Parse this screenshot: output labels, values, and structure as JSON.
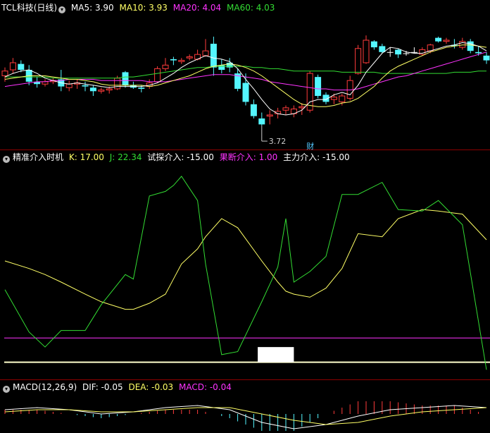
{
  "colors": {
    "up": "#ff3b3b",
    "down": "#54f6ff",
    "white": "#ffffff",
    "yellow": "#ffff66",
    "magenta": "#ff33ff",
    "green": "#33dd33"
  },
  "main_header": {
    "title": "TCL科技(日线)",
    "ma5": "MA5: 3.90",
    "ma10": "MA10: 3.93",
    "ma20": "MA20: 4.04",
    "ma60": "MA60: 4.03"
  },
  "ind_header": {
    "title": "精准介入时机",
    "k": "K: 17.00",
    "j": "J: 22.34",
    "test": "试探介入: -15.00",
    "decisive": "果断介入: 1.00",
    "main": "主力介入: -15.00"
  },
  "macd_header": {
    "title": "MACD(12,26,9)",
    "dif": "DIF: -0.05",
    "dea": "DEA: -0.03",
    "macd": "MACD: -0.04"
  },
  "annotations": {
    "low_label": "3.72",
    "marker": "财"
  },
  "chart_data": [
    {
      "type": "candlestick",
      "ylim": [
        3.55,
        4.65
      ],
      "candles": [
        [
          4.13,
          4.2,
          4.08,
          4.17
        ],
        [
          4.18,
          4.28,
          4.15,
          4.24
        ],
        [
          4.23,
          4.26,
          4.16,
          4.18
        ],
        [
          4.18,
          4.22,
          4.05,
          4.08
        ],
        [
          4.08,
          4.12,
          4.03,
          4.06
        ],
        [
          4.06,
          4.1,
          4.04,
          4.08
        ],
        [
          4.08,
          4.11,
          4.06,
          4.09
        ],
        [
          4.1,
          4.18,
          4.0,
          4.04
        ],
        [
          4.03,
          4.09,
          4.0,
          4.06
        ],
        [
          4.06,
          4.1,
          4.02,
          4.07
        ],
        [
          4.05,
          4.08,
          4.0,
          4.04
        ],
        [
          4.03,
          4.05,
          3.96,
          4.0
        ],
        [
          4.0,
          4.03,
          3.98,
          4.01
        ],
        [
          4.01,
          4.04,
          3.98,
          4.02
        ],
        [
          4.02,
          4.13,
          4.01,
          4.11
        ],
        [
          4.16,
          4.17,
          4.03,
          4.05
        ],
        [
          4.05,
          4.08,
          4.02,
          4.03
        ],
        [
          4.03,
          4.05,
          3.99,
          4.02
        ],
        [
          4.04,
          4.1,
          4.02,
          4.07
        ],
        [
          4.08,
          4.21,
          4.07,
          4.19
        ],
        [
          4.19,
          4.28,
          4.17,
          4.22
        ],
        [
          4.27,
          4.29,
          4.22,
          4.26
        ],
        [
          4.25,
          4.28,
          4.23,
          4.26
        ],
        [
          4.28,
          4.31,
          4.26,
          4.29
        ],
        [
          4.27,
          4.35,
          4.26,
          4.31
        ],
        [
          4.3,
          4.44,
          4.29,
          4.34
        ],
        [
          4.4,
          4.46,
          4.13,
          4.2
        ],
        [
          4.22,
          4.27,
          4.15,
          4.18
        ],
        [
          4.24,
          4.28,
          4.16,
          4.2
        ],
        [
          4.15,
          4.19,
          4.0,
          4.02
        ],
        [
          4.07,
          4.15,
          3.88,
          3.91
        ],
        [
          3.89,
          3.93,
          3.77,
          3.79
        ],
        [
          3.77,
          3.82,
          3.71,
          3.72
        ],
        [
          3.79,
          3.84,
          3.72,
          3.8
        ],
        [
          3.81,
          3.86,
          3.77,
          3.83
        ],
        [
          3.84,
          3.88,
          3.8,
          3.86
        ],
        [
          3.81,
          3.88,
          3.78,
          3.85
        ],
        [
          3.86,
          3.9,
          3.8,
          3.87
        ],
        [
          3.84,
          4.17,
          3.82,
          4.15
        ],
        [
          4.12,
          4.14,
          3.94,
          3.96
        ],
        [
          3.97,
          3.99,
          3.89,
          3.91
        ],
        [
          3.93,
          3.98,
          3.89,
          3.95
        ],
        [
          3.91,
          3.98,
          3.88,
          3.96
        ],
        [
          3.94,
          4.13,
          3.92,
          4.09
        ],
        [
          4.15,
          4.39,
          4.14,
          4.36
        ],
        [
          4.24,
          4.47,
          4.23,
          4.43
        ],
        [
          4.42,
          4.43,
          4.35,
          4.37
        ],
        [
          4.38,
          4.4,
          4.32,
          4.33
        ],
        [
          4.33,
          4.37,
          4.29,
          4.33
        ],
        [
          4.35,
          4.36,
          4.28,
          4.31
        ],
        [
          4.32,
          4.34,
          4.3,
          4.32
        ],
        [
          4.33,
          4.37,
          4.32,
          4.33
        ],
        [
          4.31,
          4.37,
          4.3,
          4.35
        ],
        [
          4.34,
          4.4,
          4.32,
          4.39
        ],
        [
          4.45,
          4.46,
          4.41,
          4.42
        ],
        [
          4.42,
          4.45,
          4.4,
          4.43
        ],
        [
          4.39,
          4.44,
          4.36,
          4.38
        ],
        [
          4.37,
          4.45,
          4.35,
          4.42
        ],
        [
          4.42,
          4.44,
          4.32,
          4.34
        ],
        [
          4.33,
          4.38,
          4.3,
          4.32
        ],
        [
          4.3,
          4.33,
          4.23,
          4.26
        ]
      ],
      "ma5": [
        4.12,
        4.15,
        4.17,
        4.18,
        4.15,
        4.11,
        4.09,
        4.07,
        4.06,
        4.07,
        4.06,
        4.05,
        4.04,
        4.03,
        4.04,
        4.04,
        4.04,
        4.04,
        4.05,
        4.07,
        4.11,
        4.15,
        4.2,
        4.24,
        4.27,
        4.3,
        4.28,
        4.27,
        4.25,
        4.19,
        4.1,
        4.02,
        3.93,
        3.85,
        3.81,
        3.8,
        3.81,
        3.84,
        3.91,
        3.93,
        3.93,
        3.97,
        3.99,
        3.97,
        4.05,
        4.16,
        4.24,
        4.32,
        4.37,
        4.36,
        4.33,
        4.32,
        4.32,
        4.34,
        4.36,
        4.38,
        4.39,
        4.41,
        4.4,
        4.38,
        4.34
      ],
      "ma10": [
        4.1,
        4.11,
        4.12,
        4.13,
        4.13,
        4.13,
        4.12,
        4.11,
        4.1,
        4.1,
        4.09,
        4.08,
        4.06,
        4.05,
        4.05,
        4.05,
        4.05,
        4.05,
        4.04,
        4.05,
        4.07,
        4.09,
        4.11,
        4.13,
        4.16,
        4.19,
        4.21,
        4.22,
        4.23,
        4.22,
        4.2,
        4.17,
        4.13,
        4.08,
        4.03,
        3.98,
        3.93,
        3.89,
        3.88,
        3.87,
        3.87,
        3.88,
        3.9,
        3.91,
        3.94,
        3.99,
        4.04,
        4.11,
        4.17,
        4.21,
        4.24,
        4.27,
        4.3,
        4.33,
        4.35,
        4.37,
        4.38,
        4.39,
        4.39,
        4.38,
        4.37
      ],
      "ma20": [
        4.04,
        4.05,
        4.06,
        4.07,
        4.08,
        4.08,
        4.09,
        4.09,
        4.1,
        4.1,
        4.1,
        4.1,
        4.09,
        4.09,
        4.09,
        4.09,
        4.09,
        4.09,
        4.08,
        4.08,
        4.08,
        4.09,
        4.1,
        4.11,
        4.12,
        4.13,
        4.14,
        4.14,
        4.14,
        4.13,
        4.12,
        4.11,
        4.1,
        4.08,
        4.07,
        4.06,
        4.05,
        4.04,
        4.03,
        4.02,
        4.02,
        4.01,
        4.01,
        4.01,
        4.02,
        4.04,
        4.06,
        4.08,
        4.1,
        4.12,
        4.13,
        4.15,
        4.17,
        4.19,
        4.21,
        4.23,
        4.25,
        4.27,
        4.29,
        4.31,
        4.33
      ],
      "ma60": [
        4.12,
        4.12,
        4.12,
        4.12,
        4.12,
        4.12,
        4.11,
        4.11,
        4.11,
        4.11,
        4.11,
        4.11,
        4.11,
        4.11,
        4.11,
        4.12,
        4.12,
        4.13,
        4.14,
        4.15,
        4.16,
        4.17,
        4.18,
        4.19,
        4.2,
        4.2,
        4.21,
        4.21,
        4.21,
        4.21,
        4.21,
        4.2,
        4.2,
        4.19,
        4.19,
        4.18,
        4.17,
        4.17,
        4.17,
        4.17,
        4.17,
        4.17,
        4.16,
        4.16,
        4.16,
        4.16,
        4.16,
        4.15,
        4.15,
        4.15,
        4.15,
        4.15,
        4.15,
        4.15,
        4.15,
        4.15,
        4.16,
        4.16,
        4.16,
        4.17,
        4.17
      ]
    },
    {
      "type": "line",
      "ylim": [
        -25,
        115
      ],
      "x": [
        0,
        3,
        5,
        7,
        10,
        12,
        15,
        16,
        18,
        20,
        21,
        22,
        24,
        25,
        27,
        29,
        32,
        34,
        35,
        36,
        38,
        40,
        42,
        44,
        47,
        49,
        52,
        54,
        57,
        60
      ],
      "series": [
        {
          "name": "K",
          "values": [
            52,
            47,
            43,
            38,
            30,
            25,
            20,
            20,
            24,
            30,
            40,
            50,
            60,
            68,
            80,
            74,
            52,
            38,
            32,
            30,
            28,
            34,
            47,
            70,
            68,
            80,
            86,
            85,
            83,
            66
          ]
        },
        {
          "name": "J",
          "values": [
            33,
            5,
            -5,
            6,
            6,
            23,
            43,
            40,
            95,
            98,
            102,
            108,
            92,
            50,
            -10,
            -8,
            25,
            48,
            80,
            38,
            45,
            55,
            96,
            96,
            104,
            86,
            85,
            92,
            76,
            -20
          ]
        }
      ],
      "levels": [
        {
          "name": "果断介入",
          "value": 1
        },
        {
          "name": "主力介入",
          "value": -15
        }
      ],
      "box": {
        "x": [
          31.5,
          36.0
        ],
        "y": [
          -15,
          -5
        ]
      }
    },
    {
      "type": "line",
      "ylim": [
        -0.09,
        0.09
      ],
      "x": [
        0,
        4,
        8,
        12,
        16,
        20,
        24,
        28,
        32,
        36,
        40,
        44,
        48,
        52,
        56,
        60
      ],
      "series": [
        {
          "name": "DIF",
          "values": [
            0.02,
            0.03,
            0.02,
            0.0,
            0.01,
            0.03,
            0.04,
            0.02,
            -0.04,
            -0.07,
            -0.05,
            -0.01,
            0.02,
            0.03,
            0.04,
            0.03
          ]
        },
        {
          "name": "DEA",
          "values": [
            0.01,
            0.02,
            0.02,
            0.01,
            0.01,
            0.02,
            0.03,
            0.03,
            0.0,
            -0.03,
            -0.05,
            -0.04,
            -0.01,
            0.01,
            0.02,
            0.03
          ]
        }
      ]
    }
  ]
}
